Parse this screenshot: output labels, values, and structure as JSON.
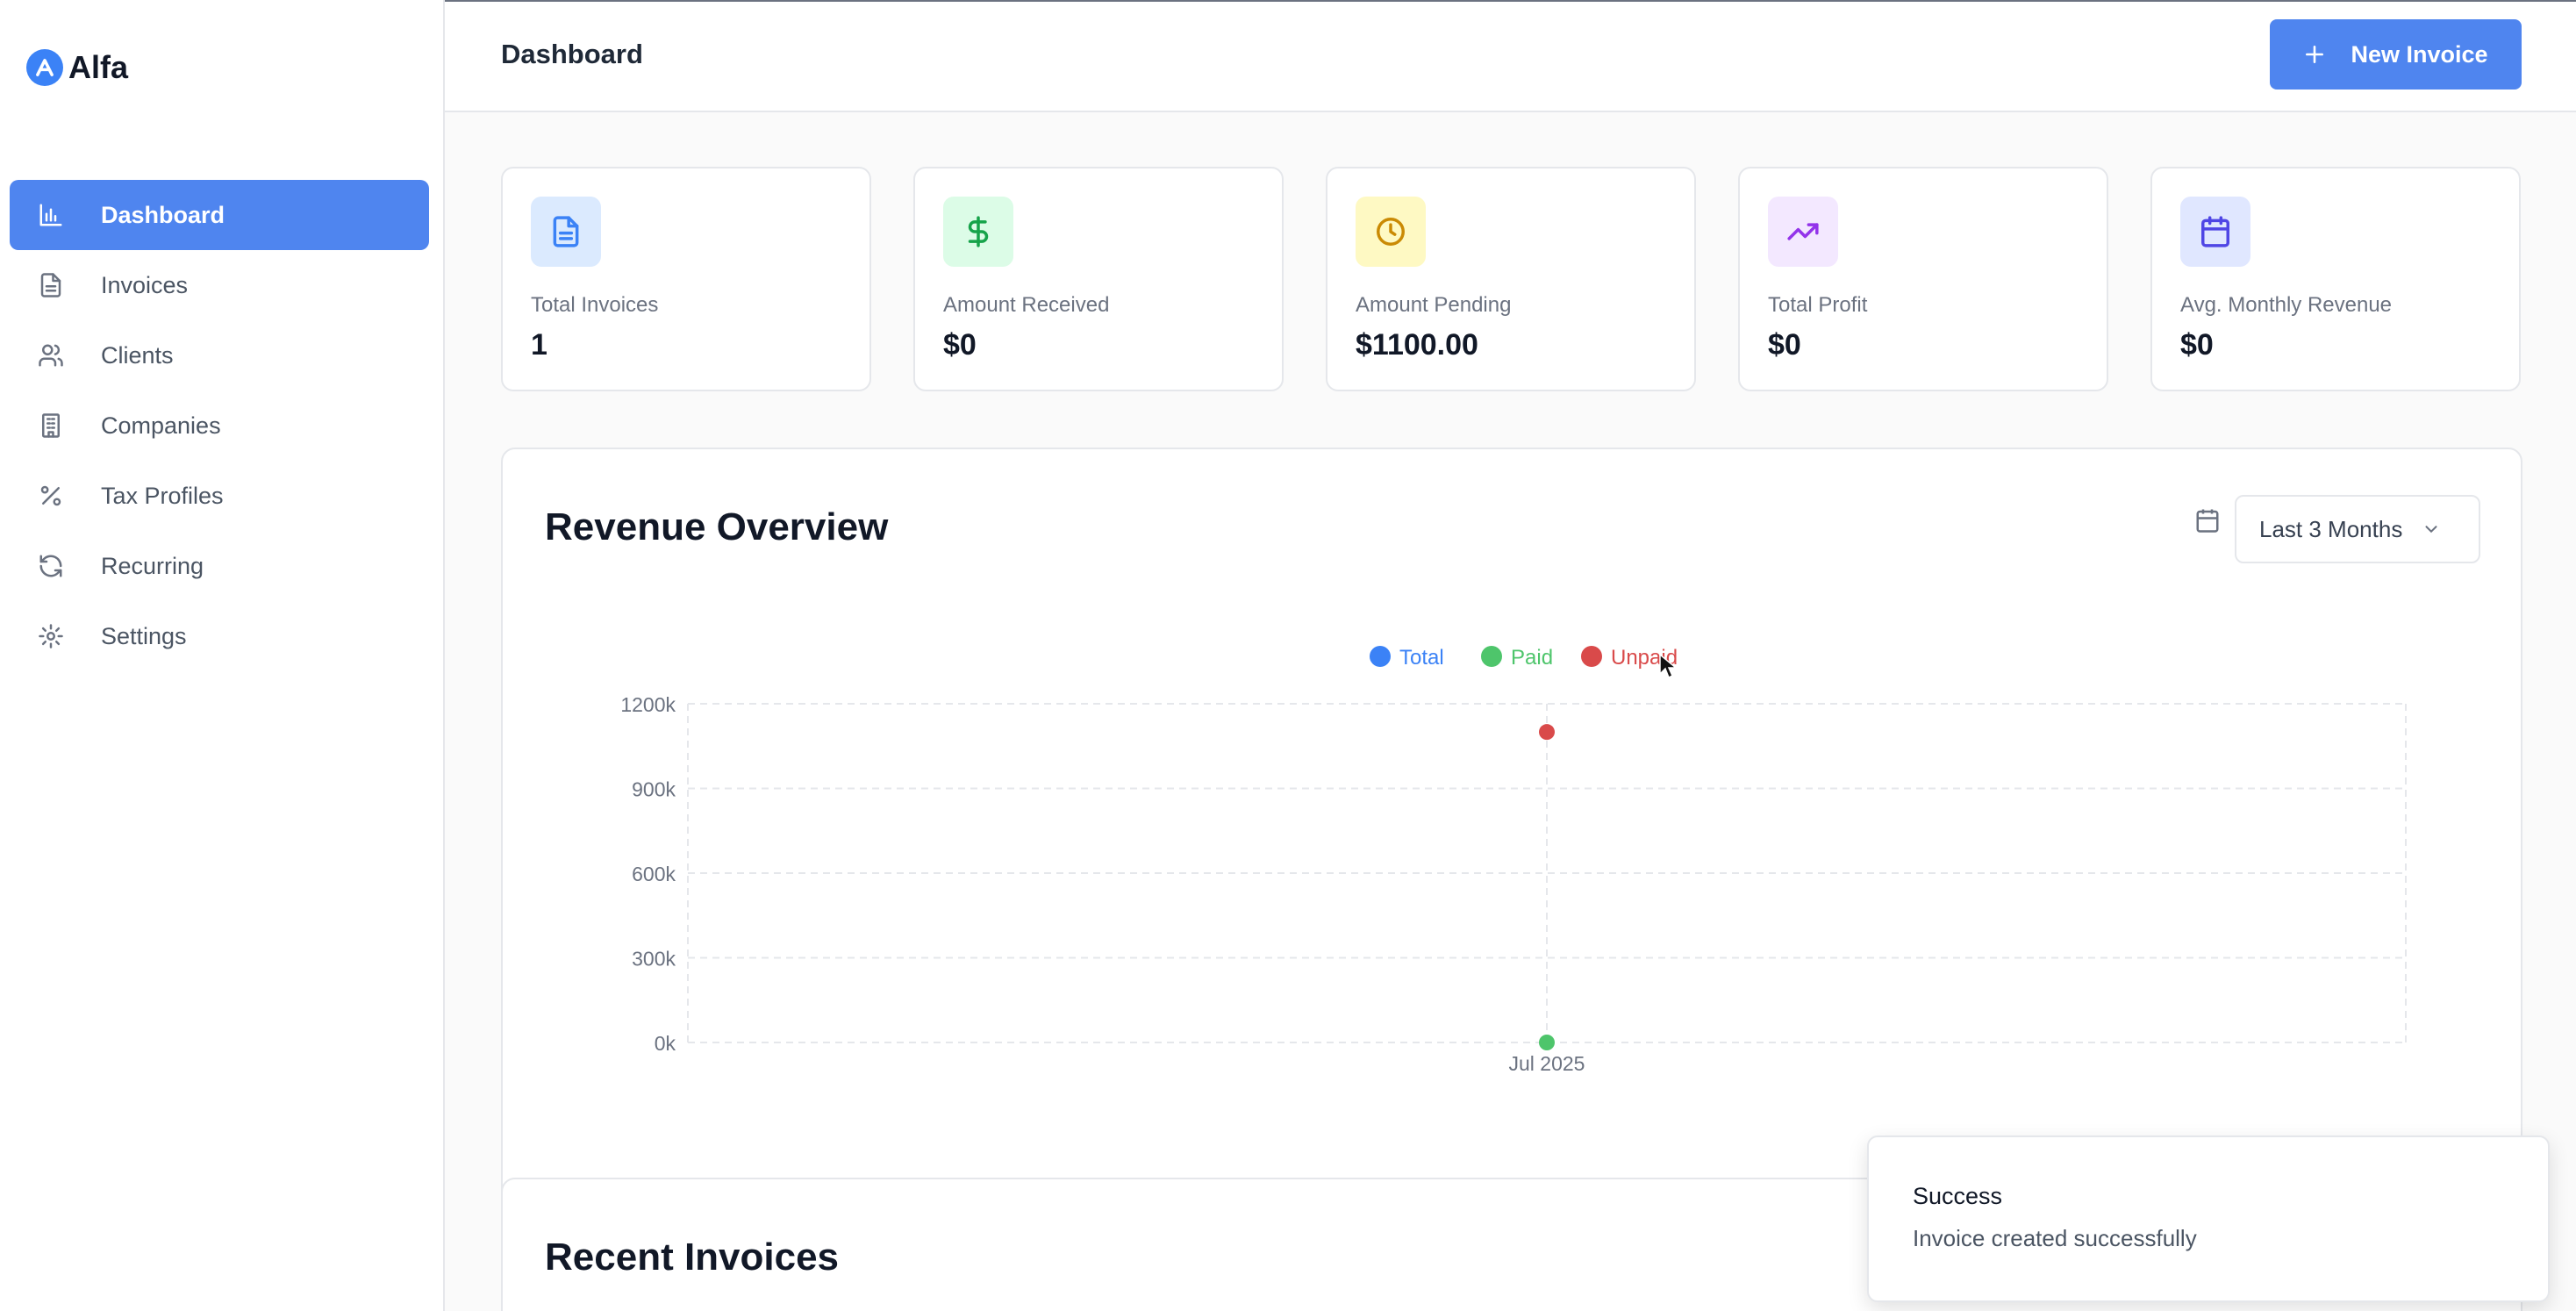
{
  "app": {
    "name": "Alfa"
  },
  "sidebar": {
    "items": [
      {
        "label": "Dashboard",
        "icon": "bar-chart-icon",
        "active": true
      },
      {
        "label": "Invoices",
        "icon": "file-icon",
        "active": false
      },
      {
        "label": "Clients",
        "icon": "users-icon",
        "active": false
      },
      {
        "label": "Companies",
        "icon": "building-icon",
        "active": false
      },
      {
        "label": "Tax Profiles",
        "icon": "percent-icon",
        "active": false
      },
      {
        "label": "Recurring",
        "icon": "refresh-icon",
        "active": false
      },
      {
        "label": "Settings",
        "icon": "gear-icon",
        "active": false
      }
    ]
  },
  "header": {
    "title": "Dashboard",
    "new_invoice_label": "New Invoice"
  },
  "stats": [
    {
      "label": "Total Invoices",
      "value": "1",
      "icon": "file-icon",
      "color": "#3b82f6",
      "bg": "#dbeafe"
    },
    {
      "label": "Amount Received",
      "value": "$0",
      "icon": "dollar-icon",
      "color": "#16a34a",
      "bg": "#dcfce7"
    },
    {
      "label": "Amount Pending",
      "value": "$1100.00",
      "icon": "clock-icon",
      "color": "#ca8a04",
      "bg": "#fef9c3"
    },
    {
      "label": "Total Profit",
      "value": "$0",
      "icon": "trending-up-icon",
      "color": "#9333ea",
      "bg": "#f3e8ff"
    },
    {
      "label": "Avg. Monthly Revenue",
      "value": "$0",
      "icon": "calendar-icon",
      "color": "#4f46e5",
      "bg": "#e0e7ff"
    }
  ],
  "revenue": {
    "title": "Revenue Overview",
    "range_label": "Last 3 Months"
  },
  "chart_data": {
    "type": "scatter",
    "title": "Revenue Overview",
    "x": [
      "Jul 2025"
    ],
    "series": [
      {
        "name": "Total",
        "color": "#3b82f6",
        "values": [
          null
        ]
      },
      {
        "name": "Paid",
        "color": "#4ec56b",
        "values": [
          0
        ]
      },
      {
        "name": "Unpaid",
        "color": "#d94a4a",
        "values": [
          1100000
        ]
      }
    ],
    "yticks": [
      "0k",
      "300k",
      "600k",
      "900k",
      "1200k"
    ],
    "ylim": [
      0,
      1200000
    ],
    "grid": true,
    "legend": "top-center"
  },
  "recent": {
    "title": "Recent Invoices"
  },
  "toast": {
    "title": "Success",
    "message": "Invoice created successfully"
  }
}
